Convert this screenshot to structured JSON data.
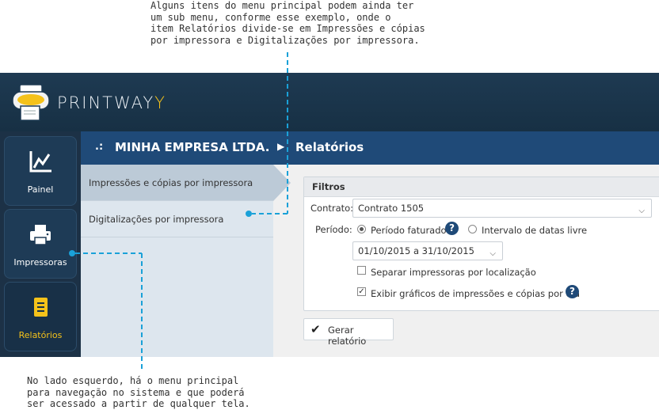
{
  "callouts": {
    "top": "Alguns itens do menu principal podem ainda ter\num sub menu, conforme esse exemplo, onde o\nitem Relatórios divide-se em Impressões e cópias\npor impressora e Digitalizações por impressora.",
    "bottom": "No lado esquerdo, há o menu principal\npara navegação no sistema e que poderá\nser acessado a partir de qualquer tela."
  },
  "brand": {
    "name_main": "PRINTWAY",
    "name_accent": "Y"
  },
  "nav": {
    "painel": "Painel",
    "impressoras": "Impressoras",
    "relatorios": "Relatórios"
  },
  "breadcrumb": {
    "prefix": ".:",
    "company": "MINHA EMPRESA LTDA.",
    "separator": "▶",
    "page": "Relatórios"
  },
  "submenu": {
    "items": [
      "Impressões e cópias por impressora",
      "Digitalizações por impressora"
    ]
  },
  "filters": {
    "title": "Filtros",
    "contract_label": "Contrato:",
    "contract_value": "Contrato 1505",
    "period_label": "Período:",
    "period_option_billed": "Período faturado",
    "period_option_free": "Intervalo de datas livre",
    "help": "?",
    "period_value": "01/10/2015 a 31/10/2015",
    "separate_by_location": "Separar impressoras por localização",
    "show_charts": "Exibir gráficos de impressões e cópias por dia",
    "show_charts_checked": true,
    "separate_checked": false
  },
  "actions": {
    "generate": "Gerar relatório"
  },
  "colors": {
    "header": "#1f4a78",
    "topbar": "#1e3a52",
    "accent_yellow": "#f5c21a",
    "dash": "#1aa1d8"
  }
}
